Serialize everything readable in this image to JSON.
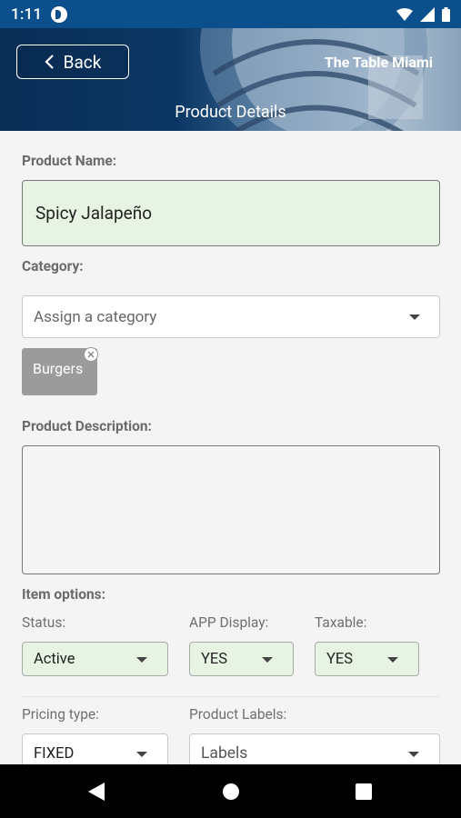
{
  "status_bar": {
    "time": "1:11"
  },
  "header": {
    "back_label": "Back",
    "restaurant_name": "The Table Miami",
    "page_title": "Product Details"
  },
  "form": {
    "product_name_label": "Product Name:",
    "product_name_value": "Spicy Jalapeño",
    "category_label": "Category:",
    "category_placeholder": "Assign a category",
    "category_chips": [
      "Burgers"
    ],
    "description_label": "Product Description:",
    "description_value": "",
    "item_options_label": "Item options:",
    "status": {
      "label": "Status:",
      "value": "Active"
    },
    "app_display": {
      "label": "APP Display:",
      "value": "YES"
    },
    "taxable": {
      "label": "Taxable:",
      "value": "YES"
    },
    "pricing_type": {
      "label": "Pricing type:",
      "value": "FIXED"
    },
    "product_labels": {
      "label": "Product Labels:",
      "placeholder": "Labels"
    }
  },
  "colors": {
    "status_bar": "#0b4f8c",
    "field_highlight": "#e8f4e3",
    "chip": "#9b9b9b",
    "background": "#f4f4f4"
  }
}
